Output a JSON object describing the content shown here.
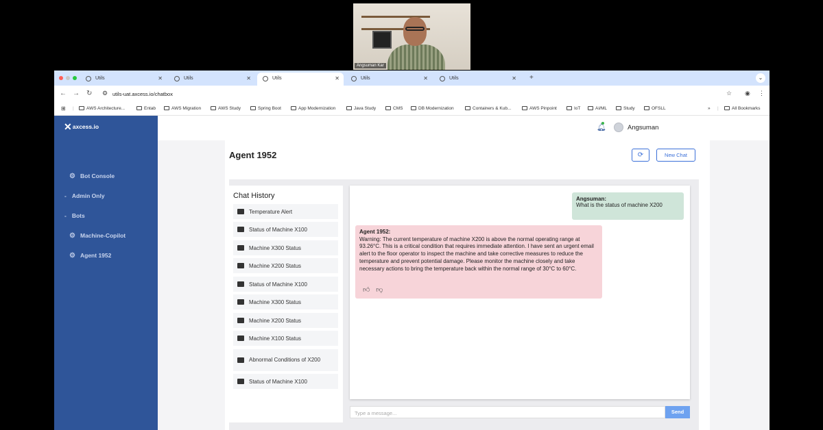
{
  "video": {
    "participant_name": "Angsuman Kar"
  },
  "browser": {
    "tabs": [
      {
        "title": "Utils",
        "active": false
      },
      {
        "title": "Utils",
        "active": false
      },
      {
        "title": "Utils",
        "active": true
      },
      {
        "title": "Utils",
        "active": false
      },
      {
        "title": "Utils",
        "active": false
      }
    ],
    "url": "utils-uat.axcess.io/chatbox",
    "bookmarks": [
      "AWS Architecture...",
      "Entab",
      "AWS Migration",
      "AWS Study",
      "Spring Boot",
      "App Modernization",
      "Java Study",
      "CMS",
      "DB Modernization",
      "Containers & Kub...",
      "AWS Pinpoint",
      "IoT",
      "AI/ML",
      "Study",
      "OFSLL"
    ],
    "all_bookmarks": "All Bookmarks",
    "more": "»"
  },
  "app": {
    "logo": "axcess.io",
    "sidebar": {
      "bot_console": "Bot Console",
      "admin_only": "Admin Only",
      "bots": "Bots",
      "machine_copilot": "Machine-Copilot",
      "agent_1952": "Agent 1952"
    },
    "header": {
      "username": "Angsuman"
    },
    "page_title": "Agent 1952",
    "refresh_icon": "⟳",
    "new_chat": "New Chat",
    "history_title": "Chat History",
    "history": [
      "Temperature Alert",
      "Status of Machine X100",
      "Machine X300 Status",
      "Machine X200 Status",
      "Status of Machine X100",
      "Machine X300 Status",
      "Machine X200 Status",
      "Machine X100 Status",
      "Abnormal Conditions of X200",
      "Status of Machine X100"
    ],
    "messages": {
      "user_name": "Angsuman:",
      "user_text": "What is the status of machine X200",
      "agent_name": "Agent 1952:",
      "agent_text": "Warning: The current temperature of machine X200 is above the normal operating range at 93.26°C. This is a critical condition that requires immediate attention. I have sent an urgent email alert to the floor operator to inspect the machine and take corrective measures to reduce the temperature and prevent potential damage. Please monitor the machine closely and take necessary actions to bring the temperature back within the normal range of 30°C to 60°C."
    },
    "input_placeholder": "Type a message...",
    "send": "Send"
  }
}
